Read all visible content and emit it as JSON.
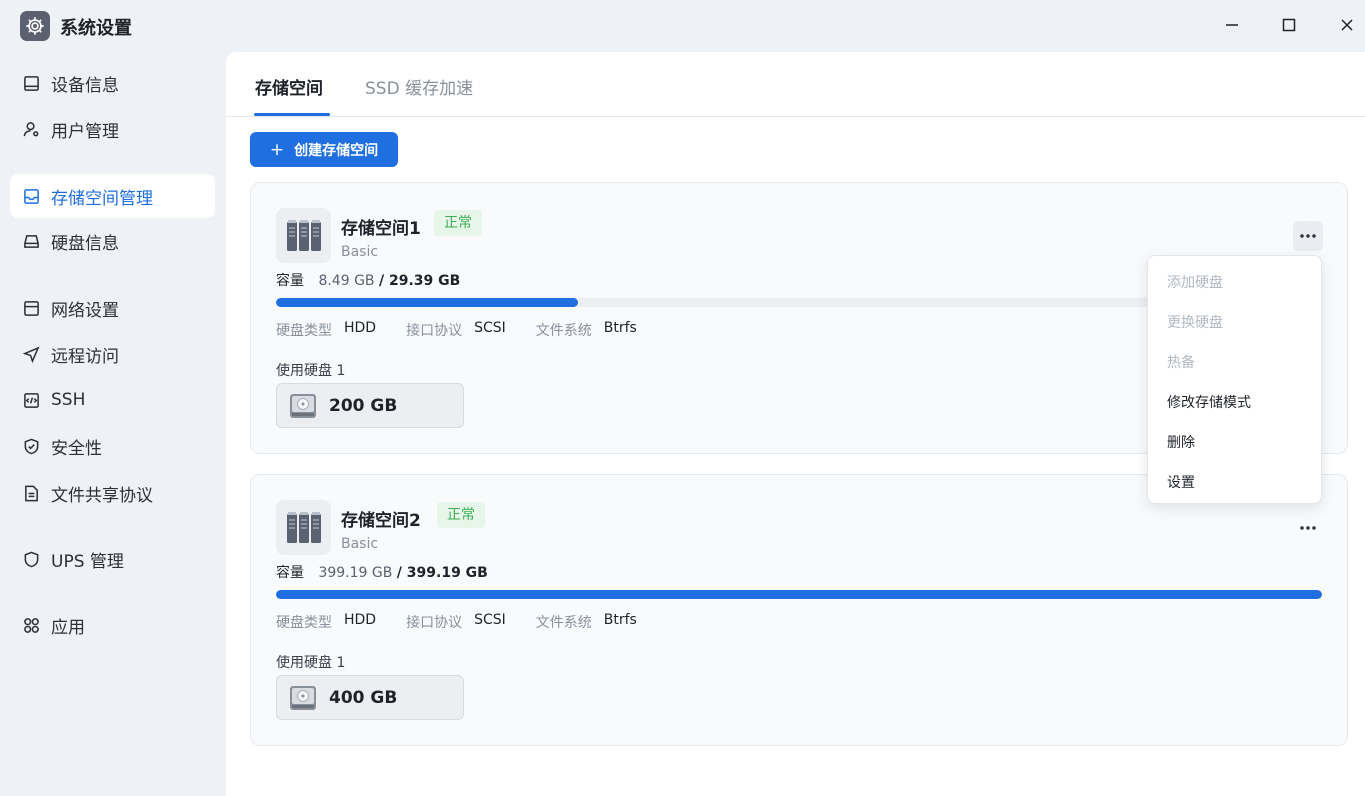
{
  "app": {
    "title": "系统设置"
  },
  "window": {
    "minimize_icon": "minimize-icon",
    "maximize_icon": "maximize-icon",
    "close_icon": "close-icon"
  },
  "sidebar": {
    "items": [
      {
        "label": "设备信息",
        "icon": "device-icon"
      },
      {
        "label": "用户管理",
        "icon": "user-icon"
      },
      {
        "label": "存储空间管理",
        "icon": "storage-icon",
        "active": true
      },
      {
        "label": "硬盘信息",
        "icon": "disk-icon"
      },
      {
        "label": "网络设置",
        "icon": "network-icon"
      },
      {
        "label": "远程访问",
        "icon": "remote-icon"
      },
      {
        "label": "SSH",
        "icon": "ssh-icon"
      },
      {
        "label": "安全性",
        "icon": "shield-icon"
      },
      {
        "label": "文件共享协议",
        "icon": "file-share-icon"
      },
      {
        "label": "UPS 管理",
        "icon": "ups-icon"
      },
      {
        "label": "应用",
        "icon": "apps-icon"
      }
    ]
  },
  "tabs": [
    {
      "label": "存储空间",
      "active": true
    },
    {
      "label": "SSD 缓存加速",
      "active": false
    }
  ],
  "toolbar": {
    "create_label": "创建存储空间",
    "create_icon": "plus-icon"
  },
  "pools": [
    {
      "name": "存储空间1",
      "status": "正常",
      "type": "Basic",
      "capacity_label": "容量",
      "used": "8.49 GB",
      "total": "/ 29.39 GB",
      "usage_fraction": 0.289,
      "disk_type_label": "硬盘类型",
      "disk_type": "HDD",
      "interface_label": "接口协议",
      "interface": "SCSI",
      "fs_label": "文件系统",
      "fs": "Btrfs",
      "disks_label": "使用硬盘 1",
      "disk_size": "200 GB"
    },
    {
      "name": "存储空间2",
      "status": "正常",
      "type": "Basic",
      "capacity_label": "容量",
      "used": "399.19 GB",
      "total": "/ 399.19 GB",
      "usage_fraction": 1.0,
      "disk_type_label": "硬盘类型",
      "disk_type": "HDD",
      "interface_label": "接口协议",
      "interface": "SCSI",
      "fs_label": "文件系统",
      "fs": "Btrfs",
      "disks_label": "使用硬盘 1",
      "disk_size": "400 GB"
    }
  ],
  "menu": {
    "items": [
      {
        "label": "添加硬盘",
        "disabled": true
      },
      {
        "label": "更换硬盘",
        "disabled": true
      },
      {
        "label": "热备",
        "disabled": true
      },
      {
        "label": "修改存储模式",
        "disabled": false
      },
      {
        "label": "删除",
        "disabled": false
      },
      {
        "label": "设置",
        "disabled": false
      }
    ]
  },
  "colors": {
    "accent": "#1f6fe0",
    "status_ok": "#3dad57",
    "status_ok_bg": "#e6f6e8"
  }
}
